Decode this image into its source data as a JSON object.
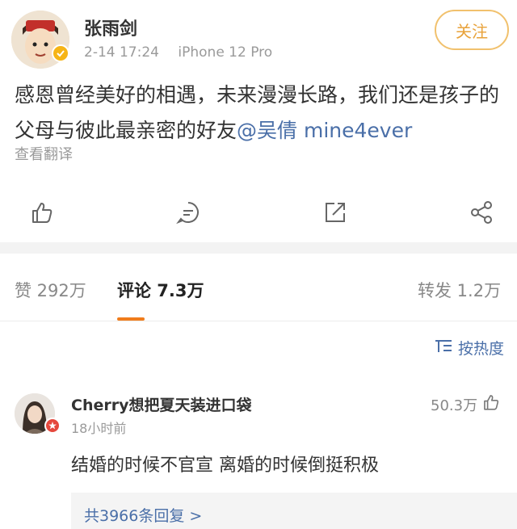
{
  "post": {
    "username": "张雨剑",
    "date": "2-14 17:24",
    "device": "iPhone 12 Pro",
    "follow_label": "关注",
    "text_before": "感恩曾经美好的相遇，未来漫漫长路，我们还是孩子的父母与彼此最亲密的好友",
    "mention": "@吴倩 mine4ever",
    "translate_label": "查看翻译",
    "actions": [
      "like-icon",
      "comment-icon",
      "repost-icon",
      "share-icon"
    ]
  },
  "tabs": {
    "likes": "赞 292万",
    "comments": "评论 7.3万",
    "reposts": "转发 1.2万"
  },
  "sort": {
    "label": "按热度"
  },
  "comment": {
    "user": "Cherry想把夏天装进口袋",
    "time": "18小时前",
    "likes": "50.3万",
    "text": "结婚的时候不官宣 离婚的时候倒挺积极",
    "replies": "共3966条回复 >"
  },
  "colors": {
    "accent": "#f07c1c",
    "link": "#4a6fa8",
    "follow": "#e8a23a"
  }
}
